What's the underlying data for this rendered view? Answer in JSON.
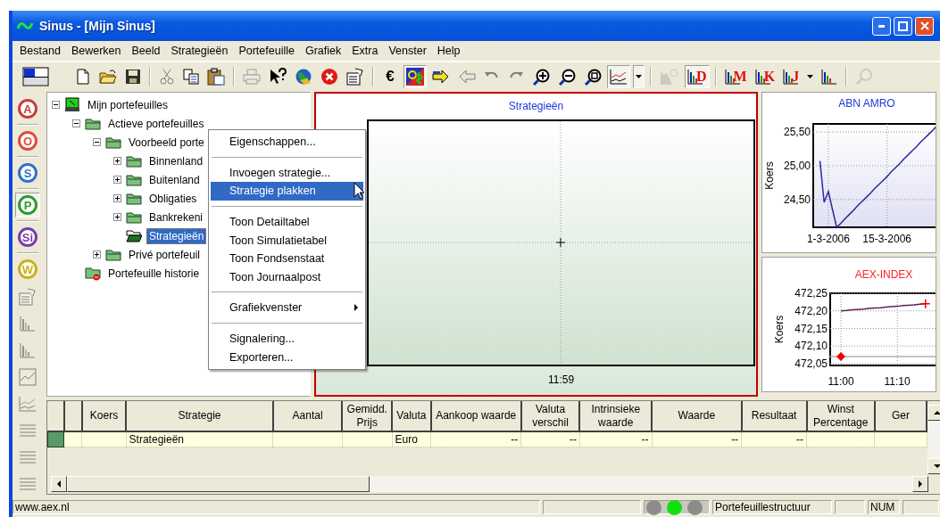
{
  "window": {
    "title": "Sinus - [Mijn Sinus]"
  },
  "menu": [
    {
      "label": "Bestand"
    },
    {
      "label": "Bewerken"
    },
    {
      "label": "Beeld"
    },
    {
      "label": "Strategieën"
    },
    {
      "label": "Portefeuille"
    },
    {
      "label": "Grafiek"
    },
    {
      "label": "Extra"
    },
    {
      "label": "Venster"
    },
    {
      "label": "Help"
    }
  ],
  "toolbar": [
    [
      {
        "kind": "layout",
        "disabled": false,
        "pressed": false
      },
      {
        "kind": "new",
        "disabled": false,
        "pressed": false
      },
      {
        "kind": "open",
        "disabled": false,
        "pressed": false
      },
      {
        "kind": "save",
        "disabled": false,
        "pressed": false
      }
    ],
    [
      {
        "kind": "cut",
        "disabled": true,
        "pressed": false
      },
      {
        "kind": "copy",
        "disabled": false,
        "pressed": false
      },
      {
        "kind": "paste",
        "disabled": false,
        "pressed": false
      }
    ],
    [
      {
        "kind": "print",
        "disabled": true,
        "pressed": false
      },
      {
        "kind": "help",
        "disabled": false,
        "pressed": false
      },
      {
        "kind": "globe",
        "disabled": false,
        "pressed": false
      },
      {
        "kind": "stop",
        "disabled": false,
        "pressed": false
      },
      {
        "kind": "properties",
        "disabled": false,
        "pressed": false
      }
    ],
    [
      {
        "kind": "glyph",
        "text": "€",
        "disabled": false,
        "pressed": false
      },
      {
        "kind": "currency",
        "disabled": false,
        "pressed": true
      },
      {
        "kind": "forward",
        "disabled": false,
        "pressed": false
      },
      {
        "kind": "back",
        "disabled": true,
        "pressed": false
      },
      {
        "kind": "undo",
        "disabled": true,
        "pressed": false
      },
      {
        "kind": "redo",
        "disabled": true,
        "pressed": false
      },
      {
        "kind": "zoom-in",
        "disabled": false,
        "pressed": false
      },
      {
        "kind": "zoom-out",
        "disabled": false,
        "pressed": false
      },
      {
        "kind": "zoom-fit",
        "disabled": false,
        "pressed": false
      },
      {
        "kind": "line-chart",
        "disabled": false,
        "pressed": true
      },
      {
        "kind": "dropdown",
        "disabled": false,
        "pressed": true
      }
    ],
    [
      {
        "kind": "pie",
        "disabled": true,
        "pressed": false
      },
      {
        "kind": "letter-bars",
        "text": "D",
        "disabled": false,
        "pressed": true
      }
    ],
    [
      {
        "kind": "letter-bars",
        "text": "M",
        "disabled": false,
        "pressed": false
      },
      {
        "kind": "letter-bars",
        "text": "K",
        "disabled": false,
        "pressed": false
      },
      {
        "kind": "letter-bars",
        "text": "J",
        "disabled": false,
        "pressed": false
      },
      {
        "kind": "dropdown",
        "disabled": false,
        "pressed": false
      },
      {
        "kind": "bars",
        "disabled": false,
        "pressed": false
      }
    ],
    [
      {
        "kind": "search",
        "disabled": true,
        "pressed": false
      }
    ]
  ],
  "sidebar": [
    {
      "kind": "letter",
      "text": "A",
      "color": "#c83c3c",
      "pressed": false,
      "disabled": false
    },
    {
      "kind": "letter",
      "text": "O",
      "color": "#e04a3a",
      "pressed": false,
      "disabled": false
    },
    {
      "kind": "letter",
      "text": "S",
      "color": "#2f6fd0",
      "pressed": false,
      "disabled": false
    },
    {
      "kind": "letter",
      "text": "P",
      "color": "#2e9a2e",
      "pressed": true,
      "disabled": false
    },
    {
      "kind": "letter",
      "text": "Si",
      "color": "#7a3aa8",
      "pressed": false,
      "disabled": false
    },
    {
      "kind": "letter",
      "text": "W",
      "color": "#c8b020",
      "pressed": false,
      "disabled": false
    },
    {
      "kind": "properties",
      "pressed": false,
      "disabled": true
    },
    {
      "kind": "bars",
      "pressed": false,
      "disabled": true
    },
    {
      "kind": "bars",
      "pressed": false,
      "disabled": true
    },
    {
      "kind": "grid-chart",
      "pressed": false,
      "disabled": true
    },
    {
      "kind": "line-chart",
      "pressed": false,
      "disabled": true
    },
    {
      "kind": "table",
      "pressed": false,
      "disabled": true
    },
    {
      "kind": "table",
      "pressed": false,
      "disabled": true
    },
    {
      "kind": "table",
      "pressed": false,
      "disabled": true
    }
  ],
  "tree": [
    {
      "label": "Mijn portefeuilles",
      "kind": "root",
      "expandable": true,
      "expanded": true,
      "selected": false,
      "children": [
        {
          "label": "Actieve portefeuilles",
          "kind": "folder",
          "expandable": true,
          "expanded": true,
          "selected": false,
          "children": [
            {
              "label": "Voorbeeld porte",
              "kind": "folder",
              "expandable": true,
              "expanded": true,
              "selected": false,
              "children": [
                {
                  "label": "Binnenland",
                  "kind": "folder",
                  "expandable": true,
                  "expanded": false,
                  "selected": false
                },
                {
                  "label": "Buitenland",
                  "kind": "folder",
                  "expandable": true,
                  "expanded": false,
                  "selected": false
                },
                {
                  "label": "Obligaties",
                  "kind": "folder",
                  "expandable": true,
                  "expanded": false,
                  "selected": false
                },
                {
                  "label": "Bankrekeni",
                  "kind": "folder",
                  "expandable": true,
                  "expanded": false,
                  "selected": false
                },
                {
                  "label": "Strategieën",
                  "kind": "open-folder",
                  "expandable": false,
                  "expanded": false,
                  "selected": true
                }
              ]
            },
            {
              "label": "Privé portefeuil",
              "kind": "folder",
              "expandable": true,
              "expanded": false,
              "selected": false
            }
          ]
        },
        {
          "label": "Portefeuille historie",
          "kind": "history-folder",
          "expandable": false,
          "expanded": false,
          "selected": false
        }
      ]
    }
  ],
  "context_menu": [
    {
      "kind": "item",
      "label": "Eigenschappen...",
      "selected": false
    },
    {
      "kind": "separator"
    },
    {
      "kind": "item",
      "label": "Invoegen strategie...",
      "selected": false
    },
    {
      "kind": "item",
      "label": "Strategie plakken",
      "selected": true
    },
    {
      "kind": "separator"
    },
    {
      "kind": "item",
      "label": "Toon Detailtabel",
      "selected": false
    },
    {
      "kind": "item",
      "label": "Toon Simulatietabel",
      "selected": false
    },
    {
      "kind": "item",
      "label": "Toon Fondsenstaat",
      "selected": false
    },
    {
      "kind": "item",
      "label": "Toon Journaalpost",
      "selected": false
    },
    {
      "kind": "separator"
    },
    {
      "kind": "submenu",
      "label": "Grafiekvenster",
      "selected": false
    },
    {
      "kind": "separator"
    },
    {
      "kind": "item",
      "label": "Signalering...",
      "selected": false
    },
    {
      "kind": "item",
      "label": "Exporteren...",
      "selected": false
    }
  ],
  "strategy_chart": {
    "title": "Strategieën",
    "x_label": "11:59"
  },
  "right_charts": [
    {
      "chart_data": {
        "type": "line",
        "title": "ABN AMRO",
        "ylabel": "Koers",
        "categories": [
          null,
          null,
          null,
          "1-3-2006",
          null,
          null,
          null,
          null,
          null,
          null,
          null,
          null,
          null,
          null,
          null,
          null,
          null,
          "15-3-2006",
          null,
          null,
          null,
          null,
          null,
          null,
          null,
          null,
          null,
          null,
          null,
          null
        ],
        "series": [
          {
            "color": "#2a2aa0",
            "values": [
              null,
              25.07,
              24.46,
              24.62,
              24.35,
              24.09,
              24.15,
              24.22,
              24.28,
              24.34,
              24.41,
              24.47,
              24.53,
              24.59,
              24.66,
              24.72,
              24.78,
              24.84,
              24.91,
              24.97,
              25.03,
              25.1,
              25.16,
              25.22,
              25.28,
              25.35,
              25.41,
              25.47,
              25.53,
              25.6
            ]
          }
        ],
        "ylim": [
          24.09,
          25.62
        ],
        "grid": true,
        "yticks": [
          {
            "value": 24.5,
            "label": "24,50"
          },
          {
            "value": 25,
            "label": "25,00"
          },
          {
            "value": 25.5,
            "label": "25,50"
          }
        ]
      }
    },
    {
      "chart_data": {
        "type": "line",
        "title": "AEX-INDEX",
        "ylabel": "Koers",
        "categories": [
          null,
          null,
          "11:00",
          null,
          null,
          null,
          null,
          null,
          null,
          null,
          null,
          null,
          "11:10",
          null,
          null,
          null,
          null,
          null,
          null,
          null
        ],
        "series": [
          {
            "color": "#602050",
            "values": [
              null,
              null,
              472.2,
              472.201,
              472.203,
              472.204,
              472.205,
              472.207,
              472.208,
              472.209,
              472.211,
              472.212,
              472.213,
              472.215,
              472.216,
              472.217,
              472.219,
              472.22,
              null,
              null
            ]
          },
          {
            "color": "#b0b0b0",
            "values": [
              472.07,
              472.07,
              null,
              472.07,
              472.07,
              472.07,
              472.07,
              472.07,
              472.07,
              472.07,
              472.07,
              472.07,
              472.07,
              472.07,
              472.07,
              472.07,
              472.07,
              472.07,
              472.07,
              472.07
            ]
          },
          {
            "color": "#f00000",
            "marker": "diamond",
            "values": [
              null,
              null,
              472.07,
              null,
              null,
              null,
              null,
              null,
              null,
              null,
              null,
              null,
              null,
              null,
              null,
              null,
              null,
              null,
              null,
              null
            ]
          }
        ],
        "ylim": [
          472.045,
          472.25
        ],
        "grid": true,
        "yticks": [
          {
            "value": 472.05,
            "label": "472,05"
          },
          {
            "value": 472.1,
            "label": "472,10"
          },
          {
            "value": 472.15,
            "label": "472,15"
          },
          {
            "value": 472.2,
            "label": "472,20"
          },
          {
            "value": 472.25,
            "label": "472,25"
          }
        ]
      }
    }
  ],
  "table": {
    "columns": [
      {
        "label": "Koers"
      },
      {
        "label": "Strategie"
      },
      {
        "label": "Aantal"
      },
      {
        "label": "Gemidd. Prijs"
      },
      {
        "label": "Valuta"
      },
      {
        "label": "Aankoop waarde"
      },
      {
        "label": "Valuta verschil"
      },
      {
        "label": "Intrinsieke waarde"
      },
      {
        "label": "Waarde"
      },
      {
        "label": "Resultaat"
      },
      {
        "label": "Winst Percentage"
      },
      {
        "label": "Ger"
      }
    ],
    "rows": [
      {
        "selected": true,
        "cells": [
          null,
          "Strategieën",
          null,
          null,
          "Euro",
          "--",
          "--",
          "--",
          "--",
          "--",
          null,
          null
        ]
      }
    ]
  },
  "status_bar": {
    "url": "www.aex.nl",
    "lights": [
      {
        "color": "#8c8c8c"
      },
      {
        "color": "#10e010"
      },
      {
        "color": "#8c8c8c"
      }
    ],
    "mode": "Portefeuillestructuur",
    "num": "NUM"
  }
}
